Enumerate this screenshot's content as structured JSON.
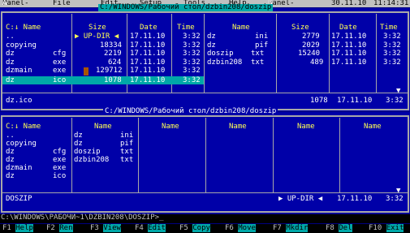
{
  "menu": {
    "items": [
      "Panel-",
      "File",
      "Edit",
      "Setup",
      "Tools",
      "Help",
      "Panel-"
    ],
    "hotkeys": [
      "A",
      "",
      "",
      "",
      "",
      "",
      "B"
    ],
    "date": "30.11.10",
    "time": "11:14:31"
  },
  "top_panel": {
    "title": "C:/WINDOWS/Рабочий стол/dzbin208/doszip",
    "left_headers": [
      "C:↓ Name",
      "Size",
      "Date",
      "Time"
    ],
    "right_headers": [
      "Name",
      "Size",
      "Date",
      "Time"
    ],
    "left_rows": [
      {
        "name": "..",
        "ext": "",
        "size": "▶ UP-DIR ◀",
        "date": "17.11.10",
        "time": "3:32"
      },
      {
        "name": "copying",
        "ext": "",
        "size": "18334",
        "date": "17.11.10",
        "time": "3:32"
      },
      {
        "name": "dz",
        "ext": "cfg",
        "size": "2219",
        "date": "17.11.10",
        "time": "3:32"
      },
      {
        "name": "dz",
        "ext": "exe",
        "size": "624",
        "date": "17.11.10",
        "time": "3:32"
      },
      {
        "name": "dzmain",
        "ext": "exe",
        "size": "129712",
        "date": "17.11.10",
        "time": "3:32"
      },
      {
        "name": "dz",
        "ext": "ico",
        "size": "1078",
        "date": "17.11.10",
        "time": "3:32"
      }
    ],
    "right_rows": [
      {
        "name": "dz",
        "ext": "ini",
        "size": "2779",
        "date": "17.11.10",
        "time": "3:32"
      },
      {
        "name": "dz",
        "ext": "pif",
        "size": "2029",
        "date": "17.11.10",
        "time": "3:32"
      },
      {
        "name": "doszip",
        "ext": "txt",
        "size": "15240",
        "date": "17.11.10",
        "time": "3:32"
      },
      {
        "name": "dzbin208",
        "ext": "txt",
        "size": "489",
        "date": "17.11.10",
        "time": "3:32"
      }
    ],
    "status": {
      "name": "dz.ico",
      "size": "1078",
      "date": "17.11.10",
      "time": "3:32"
    }
  },
  "bottom_panel": {
    "title": "C:/WINDOWS/Рабочий стол/dzbin208/doszip",
    "headers": [
      "C:↓ Name",
      "Name",
      "Name",
      "Name",
      "Name",
      "Name"
    ],
    "col1": [
      {
        "name": "..",
        "ext": ""
      },
      {
        "name": "copying",
        "ext": ""
      },
      {
        "name": "dz",
        "ext": "cfg"
      },
      {
        "name": "dz",
        "ext": "exe"
      },
      {
        "name": "dzmain",
        "ext": "exe"
      },
      {
        "name": "dz",
        "ext": "ico"
      }
    ],
    "col2": [
      {
        "name": "dz",
        "ext": "ini"
      },
      {
        "name": "dz",
        "ext": "pif"
      },
      {
        "name": "doszip",
        "ext": "txt"
      },
      {
        "name": "dzbin208",
        "ext": "txt"
      }
    ],
    "status": {
      "name": "DOSZIP",
      "size": "▶ UP-DIR ◀",
      "date": "17.11.10",
      "time": "3:32"
    }
  },
  "command_line": "C:\\WINDOWS\\РАБОЧИ~1\\DZBIN208\\DOSZIP>_",
  "fkeys": [
    {
      "num": "F1",
      "label": "Help"
    },
    {
      "num": "F2",
      "label": "Ren"
    },
    {
      "num": "F3",
      "label": "View"
    },
    {
      "num": "F4",
      "label": "Edit"
    },
    {
      "num": "F5",
      "label": "Copy"
    },
    {
      "num": "F6",
      "label": "Move"
    },
    {
      "num": "F7",
      "label": "Mkdir"
    },
    {
      "num": "F8",
      "label": "Del"
    },
    {
      "num": "F10",
      "label": "Exit"
    }
  ],
  "colors": {
    "panel": "#0000a8",
    "header": "#ffff55",
    "selection": "#00a8a8",
    "menubar": "#c0c0c0"
  }
}
